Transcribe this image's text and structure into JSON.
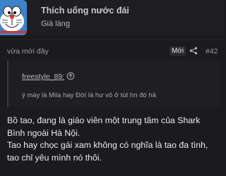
{
  "author": {
    "name": "Thích uống nước đái",
    "title": "Già làng",
    "avatar_icon": "doraemon-avatar-icon"
  },
  "meta": {
    "time": "vừa mới đây",
    "new_badge": "Mới",
    "share_icon": "share-icon",
    "post_number": "#42"
  },
  "quote": {
    "author": "freestyle_89:",
    "jump_icon": "arrow-up-circle-icon",
    "text": "ý mày là Mila hay Đời là hư vô ở tút hn đó hả"
  },
  "body": {
    "paragraphs": [
      "Bồ tao, đang là giáo viên một trung tâm của Shark Bình ngoài Hà Nội.",
      "Tao hay chọc gái xam không có nghĩa là tao đa tình, tao chỉ yêu mình nó thôi."
    ]
  },
  "colors": {
    "background": "#1b1b1e",
    "avatar_blue": "#3b83c8"
  }
}
